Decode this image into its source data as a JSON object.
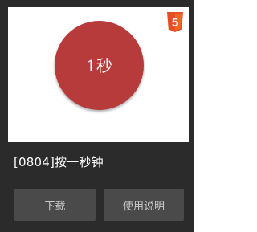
{
  "preview": {
    "circle_label": "1秒",
    "circle_color": "#b83b3b",
    "badge_icon": "html5-icon",
    "badge_color": "#e44d26",
    "badge_text": "5"
  },
  "card": {
    "title": "[0804]按一秒钟",
    "background": "#2b2b2b"
  },
  "buttons": {
    "download_label": "下载",
    "manual_label": "使用说明"
  }
}
